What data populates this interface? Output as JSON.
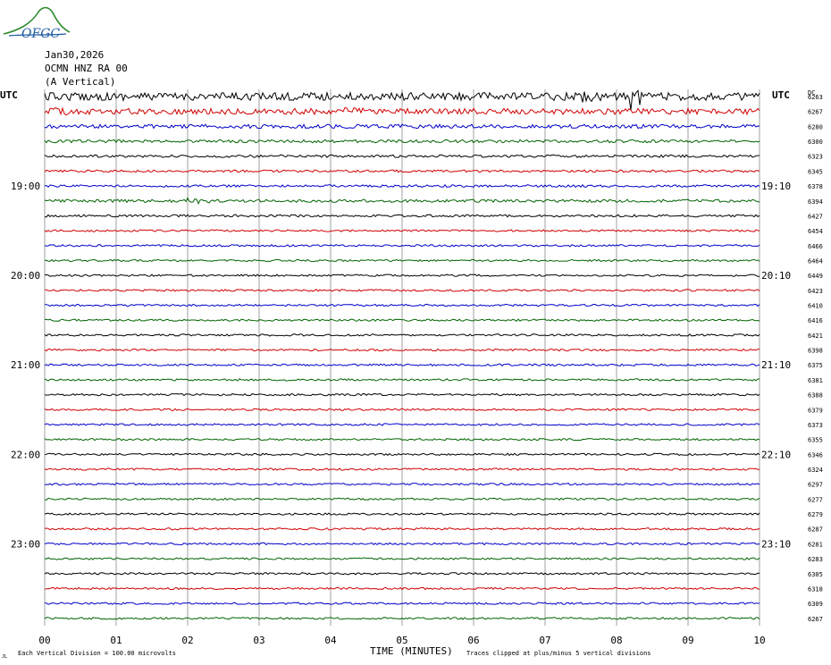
{
  "logo": {
    "text": "OFGC",
    "icon": "volcano-logo"
  },
  "header": {
    "date": "Jan30,2026",
    "station": "OCMN HNZ RA 00",
    "component": "(A Vertical)"
  },
  "labels": {
    "utc_left": "UTC",
    "utc_right": "UTC",
    "dc": "DC",
    "xlabel": "TIME (MINUTES)",
    "scale_note": "Each Vertical Division =  100.00 microvolts",
    "clip_note": "Traces clipped at plus/minus 5 vertical divisions",
    "corner_mark": "JL"
  },
  "colors": {
    "cycle": [
      "#000000",
      "#d00000",
      "#0000c8",
      "#006400"
    ],
    "grid": "#888888"
  },
  "chart_data": {
    "type": "line",
    "title": "",
    "xlabel": "TIME (MINUTES)",
    "x_ticks": [
      "00",
      "01",
      "02",
      "03",
      "04",
      "05",
      "06",
      "07",
      "08",
      "09",
      "10"
    ],
    "xlim": [
      0,
      10
    ],
    "left_hour_labels": [
      "19:00",
      "20:00",
      "21:00",
      "22:00",
      "23:00"
    ],
    "right_hour_labels": [
      "19:10",
      "20:10",
      "21:10",
      "22:10",
      "23:10"
    ],
    "hour_label_rows": [
      6,
      12,
      18,
      24,
      30
    ],
    "dc_offsets": [
      6263,
      6267,
      6280,
      6300,
      6323,
      6345,
      6378,
      6394,
      6427,
      6454,
      6466,
      6464,
      6449,
      6423,
      6410,
      6416,
      6421,
      6398,
      6375,
      6381,
      6388,
      6379,
      6373,
      6355,
      6346,
      6324,
      6297,
      6277,
      6279,
      6287,
      6281,
      6283,
      6305,
      6318,
      6309,
      6267
    ],
    "amplitude_scale": [
      4,
      3,
      2,
      1.5,
      1.3,
      1.2,
      1.2,
      1.5,
      1.2,
      1,
      1,
      1,
      1,
      1,
      1,
      1,
      1,
      1,
      1,
      1,
      1,
      1,
      1,
      1,
      1,
      1,
      1,
      1,
      1,
      1,
      1,
      1,
      1,
      1,
      1,
      1
    ],
    "events": [
      {
        "row": 0,
        "minute": 8.2,
        "peak_divisions": 5
      },
      {
        "row": 0,
        "minute": 7.45,
        "peak_divisions": 3
      },
      {
        "row": 0,
        "minute": 3.4,
        "peak_divisions": 2
      },
      {
        "row": 1,
        "minute": 4.2,
        "peak_divisions": 2
      },
      {
        "row": 1,
        "minute": 0.1,
        "peak_divisions": 1.5
      },
      {
        "row": 7,
        "minute": 2.0,
        "peak_divisions": 2
      }
    ]
  }
}
